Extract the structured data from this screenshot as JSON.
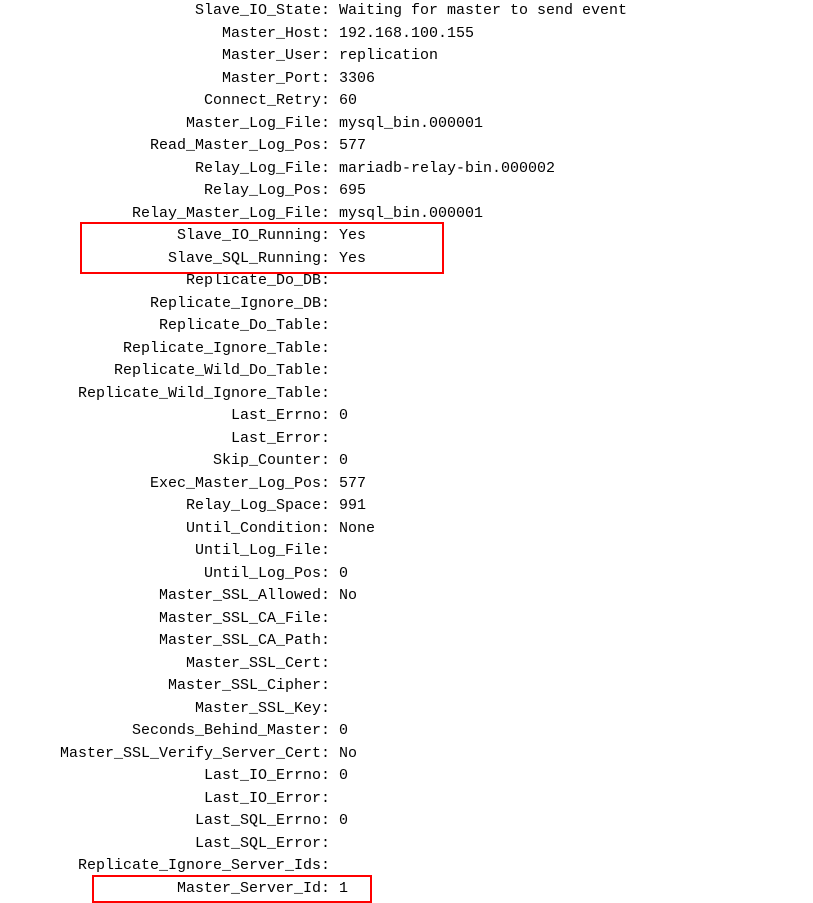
{
  "status": {
    "rows": [
      {
        "label": "Slave_IO_State:",
        "value": "Waiting for master to send event"
      },
      {
        "label": "Master_Host:",
        "value": "192.168.100.155"
      },
      {
        "label": "Master_User:",
        "value": "replication"
      },
      {
        "label": "Master_Port:",
        "value": "3306"
      },
      {
        "label": "Connect_Retry:",
        "value": "60"
      },
      {
        "label": "Master_Log_File:",
        "value": "mysql_bin.000001"
      },
      {
        "label": "Read_Master_Log_Pos:",
        "value": "577"
      },
      {
        "label": "Relay_Log_File:",
        "value": "mariadb-relay-bin.000002"
      },
      {
        "label": "Relay_Log_Pos:",
        "value": "695"
      },
      {
        "label": "Relay_Master_Log_File:",
        "value": "mysql_bin.000001"
      },
      {
        "label": "Slave_IO_Running:",
        "value": "Yes"
      },
      {
        "label": "Slave_SQL_Running:",
        "value": "Yes"
      },
      {
        "label": "Replicate_Do_DB:",
        "value": ""
      },
      {
        "label": "Replicate_Ignore_DB:",
        "value": ""
      },
      {
        "label": "Replicate_Do_Table:",
        "value": ""
      },
      {
        "label": "Replicate_Ignore_Table:",
        "value": ""
      },
      {
        "label": "Replicate_Wild_Do_Table:",
        "value": ""
      },
      {
        "label": "Replicate_Wild_Ignore_Table:",
        "value": ""
      },
      {
        "label": "Last_Errno:",
        "value": "0"
      },
      {
        "label": "Last_Error:",
        "value": ""
      },
      {
        "label": "Skip_Counter:",
        "value": "0"
      },
      {
        "label": "Exec_Master_Log_Pos:",
        "value": "577"
      },
      {
        "label": "Relay_Log_Space:",
        "value": "991"
      },
      {
        "label": "Until_Condition:",
        "value": "None"
      },
      {
        "label": "Until_Log_File:",
        "value": ""
      },
      {
        "label": "Until_Log_Pos:",
        "value": "0"
      },
      {
        "label": "Master_SSL_Allowed:",
        "value": "No"
      },
      {
        "label": "Master_SSL_CA_File:",
        "value": ""
      },
      {
        "label": "Master_SSL_CA_Path:",
        "value": ""
      },
      {
        "label": "Master_SSL_Cert:",
        "value": ""
      },
      {
        "label": "Master_SSL_Cipher:",
        "value": ""
      },
      {
        "label": "Master_SSL_Key:",
        "value": ""
      },
      {
        "label": "Seconds_Behind_Master:",
        "value": "0"
      },
      {
        "label": "Master_SSL_Verify_Server_Cert:",
        "value": "No"
      },
      {
        "label": "Last_IO_Errno:",
        "value": "0"
      },
      {
        "label": "Last_IO_Error:",
        "value": ""
      },
      {
        "label": "Last_SQL_Errno:",
        "value": "0"
      },
      {
        "label": "Last_SQL_Error:",
        "value": ""
      },
      {
        "label": "Replicate_Ignore_Server_Ids:",
        "value": ""
      },
      {
        "label": "Master_Server_Id:",
        "value": "1"
      }
    ]
  }
}
